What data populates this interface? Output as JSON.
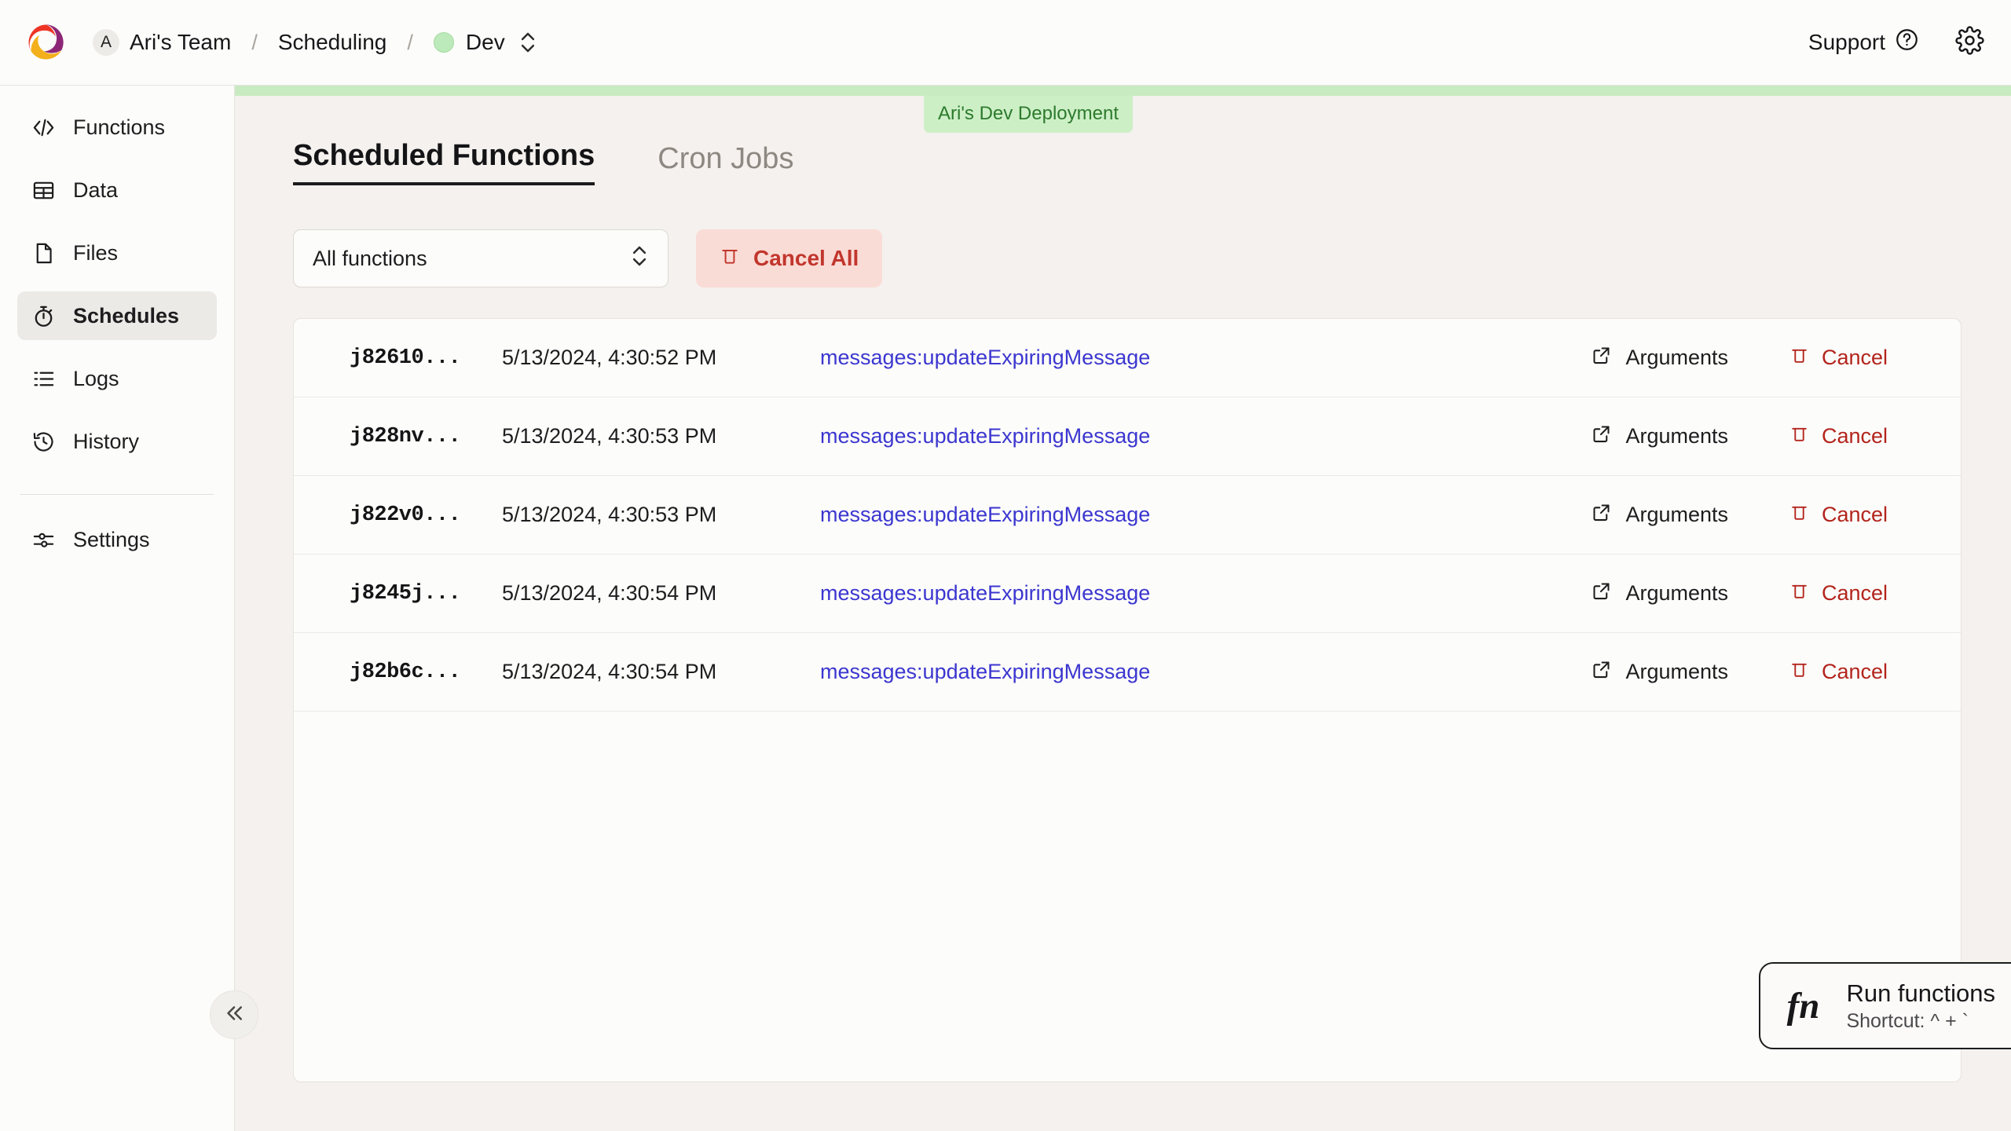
{
  "header": {
    "logo_icon": "convex-logo",
    "team_initial": "A",
    "team_name": "Ari's Team",
    "separator": "/",
    "project_name": "Scheduling",
    "environment": "Dev",
    "env_dot_color": "#bdeaba",
    "env_switcher_icon": "chevron-up-down-icon",
    "support_label": "Support",
    "support_icon": "question-circle-icon",
    "settings_icon": "gear-icon"
  },
  "sidebar": {
    "items": [
      {
        "label": "Functions",
        "icon": "code-brackets-icon",
        "active": false
      },
      {
        "label": "Data",
        "icon": "table-icon",
        "active": false
      },
      {
        "label": "Files",
        "icon": "file-icon",
        "active": false
      },
      {
        "label": "Schedules",
        "icon": "stopwatch-icon",
        "active": true
      },
      {
        "label": "Logs",
        "icon": "list-icon",
        "active": false
      },
      {
        "label": "History",
        "icon": "clock-rewind-icon",
        "active": false
      }
    ],
    "settings": {
      "label": "Settings",
      "icon": "sliders-icon"
    },
    "collapse_icon": "chevrons-left-icon"
  },
  "main": {
    "deployment_badge": "Ari's Dev Deployment",
    "deployment_bar_color": "#c9ebc2",
    "tabs": [
      {
        "label": "Scheduled Functions",
        "active": true
      },
      {
        "label": "Cron Jobs",
        "active": false
      }
    ],
    "filter": {
      "value": "All functions",
      "icon": "chevron-up-down-icon"
    },
    "cancel_all": {
      "label": "Cancel All",
      "icon": "trash-icon",
      "color": "#c2362d",
      "background": "#fadcd6"
    },
    "rows": [
      {
        "id": "j82610...",
        "time": "5/13/2024, 4:30:52 PM",
        "function": "messages:updateExpiringMessage",
        "arguments_label": "Arguments",
        "arguments_icon": "external-link-icon",
        "cancel_label": "Cancel",
        "cancel_icon": "trash-icon"
      },
      {
        "id": "j828nv...",
        "time": "5/13/2024, 4:30:53 PM",
        "function": "messages:updateExpiringMessage",
        "arguments_label": "Arguments",
        "arguments_icon": "external-link-icon",
        "cancel_label": "Cancel",
        "cancel_icon": "trash-icon"
      },
      {
        "id": "j822v0...",
        "time": "5/13/2024, 4:30:53 PM",
        "function": "messages:updateExpiringMessage",
        "arguments_label": "Arguments",
        "arguments_icon": "external-link-icon",
        "cancel_label": "Cancel",
        "cancel_icon": "trash-icon"
      },
      {
        "id": "j8245j...",
        "time": "5/13/2024, 4:30:54 PM",
        "function": "messages:updateExpiringMessage",
        "arguments_label": "Arguments",
        "arguments_icon": "external-link-icon",
        "cancel_label": "Cancel",
        "cancel_icon": "trash-icon"
      },
      {
        "id": "j82b6c...",
        "time": "5/13/2024, 4:30:54 PM",
        "function": "messages:updateExpiringMessage",
        "arguments_label": "Arguments",
        "arguments_icon": "external-link-icon",
        "cancel_label": "Cancel",
        "cancel_icon": "trash-icon"
      }
    ],
    "function_link_color": "#3b36d0"
  },
  "run_functions": {
    "glyph": "fn",
    "title": "Run functions",
    "shortcut": "Shortcut: ^ + `"
  }
}
